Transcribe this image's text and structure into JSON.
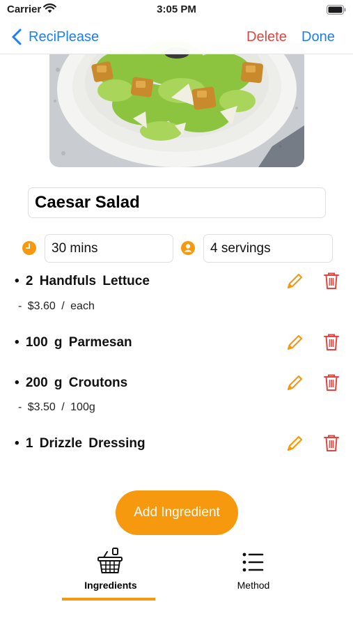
{
  "status_bar": {
    "carrier": "Carrier",
    "time": "3:05 PM"
  },
  "nav": {
    "back_label": "ReciPlease",
    "delete_label": "Delete",
    "done_label": "Done"
  },
  "recipe": {
    "title": "Caesar Salad",
    "time": "30 mins",
    "servings": "4 servings",
    "image_description": "salad-photo"
  },
  "ingredients": [
    {
      "text": "• 2 Handfuls Lettuce",
      "price": "- $3.60 / each"
    },
    {
      "text": "• 100 g Parmesan",
      "price": ""
    },
    {
      "text": "• 200 g Croutons",
      "price": "- $3.50 / 100g"
    },
    {
      "text": "• 1 Drizzle Dressing",
      "price": ""
    }
  ],
  "add_button_label": "Add Ingredient",
  "tabs": [
    {
      "label": "Ingredients",
      "icon": "basket-icon",
      "selected": true
    },
    {
      "label": "Method",
      "icon": "list-icon",
      "selected": false
    }
  ],
  "colors": {
    "accent": "#f6990f",
    "link": "#1a7ff0",
    "destructive": "#e5433e"
  }
}
